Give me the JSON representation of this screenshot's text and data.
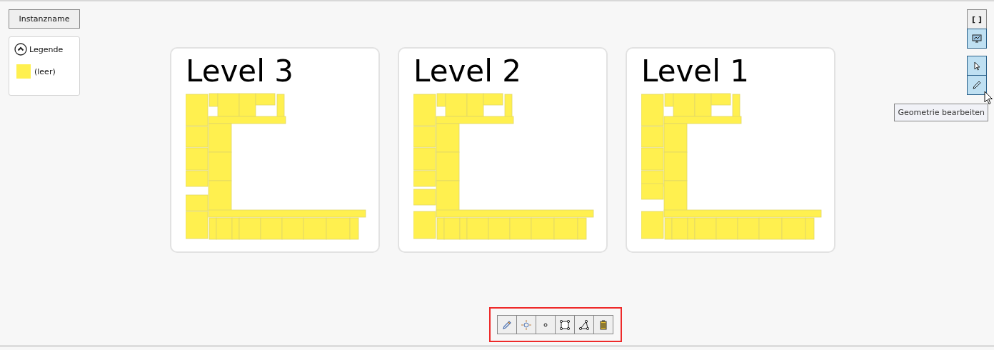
{
  "instance_button": {
    "label": "Instanzname"
  },
  "legend": {
    "title": "Legende",
    "expanded": true,
    "items": [
      {
        "label": "(leer)",
        "color": "#fff04f"
      }
    ]
  },
  "levels": [
    {
      "title": "Level 3"
    },
    {
      "title": "Level 2"
    },
    {
      "title": "Level 1"
    }
  ],
  "right_toolbar": [
    {
      "kind": "brackets",
      "label": "[ ]",
      "selected": false
    },
    {
      "kind": "monitor",
      "selected": true
    },
    {
      "kind": "pointer",
      "selected": true
    },
    {
      "kind": "pencil",
      "selected": true
    }
  ],
  "tooltip": {
    "text": "Geometrie bearbeiten"
  },
  "edit_toolbar": {
    "highlighted": true,
    "buttons": [
      {
        "kind": "pencil",
        "selected": false
      },
      {
        "kind": "move",
        "selected": false
      },
      {
        "kind": "point",
        "selected": false
      },
      {
        "kind": "rectangle",
        "selected": false
      },
      {
        "kind": "polyline",
        "selected": false
      },
      {
        "kind": "trash",
        "selected": false
      }
    ]
  }
}
